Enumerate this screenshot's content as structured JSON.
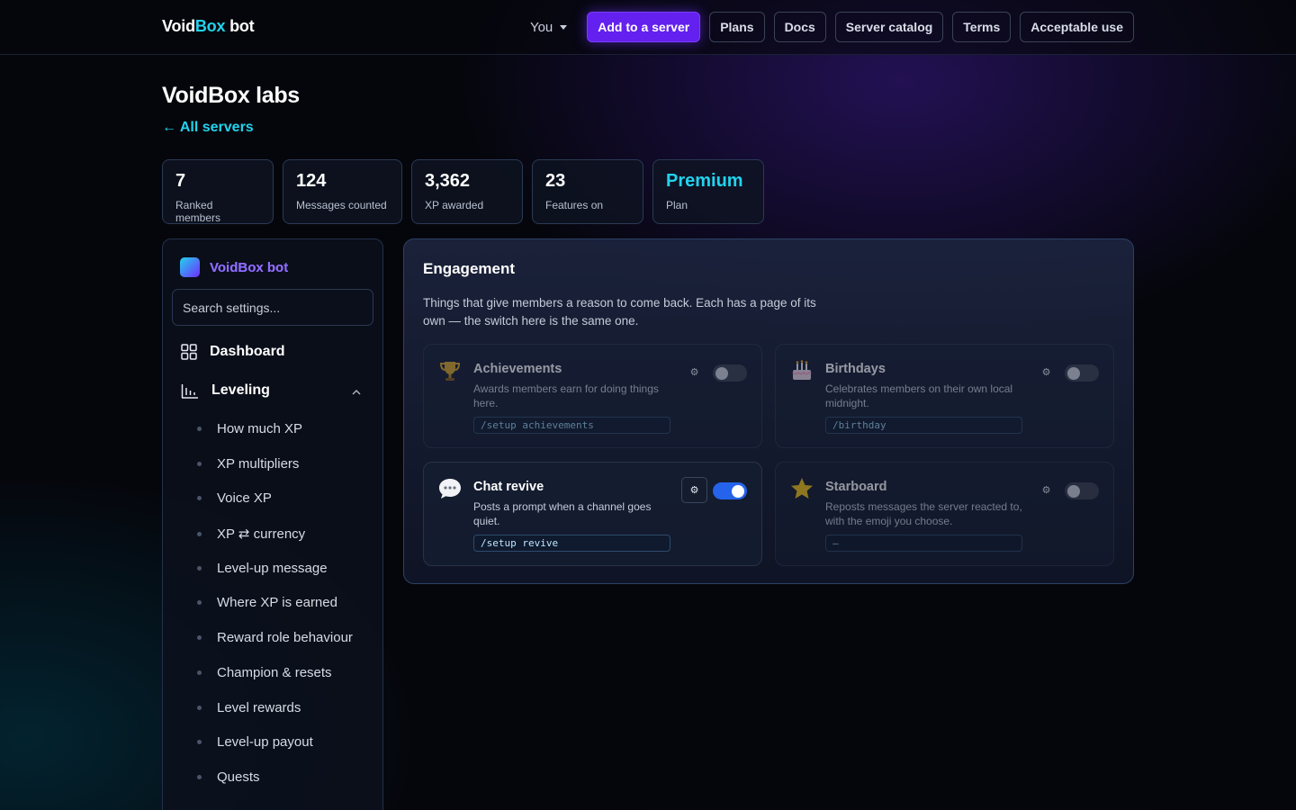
{
  "brand": {
    "prefix": "Void",
    "accent": "Box",
    "suffix": " bot"
  },
  "nav": {
    "user_label": "You",
    "add_label": "Add to a server",
    "links": [
      "Plans",
      "Docs",
      "Server catalog",
      "Terms",
      "Acceptable use"
    ]
  },
  "server": {
    "name": "VoidBox labs",
    "back_label": "← All servers"
  },
  "stats": [
    {
      "value": "7",
      "label": "Ranked members"
    },
    {
      "value": "124",
      "label": "Messages counted"
    },
    {
      "value": "3,362",
      "label": "XP awarded"
    },
    {
      "value": "23",
      "label": "Features on"
    },
    {
      "value": "Premium",
      "label": "Plan"
    }
  ],
  "sidebar": {
    "title": "VoidBox bot",
    "search_placeholder": "Search settings...",
    "dashboard_label": "Dashboard",
    "section_label": "Leveling",
    "sub_items": [
      "How much XP",
      "XP multipliers",
      "Voice XP",
      "XP ⇄ currency",
      "Level-up message",
      "Where XP is earned",
      "Reward role behaviour",
      "Champion & resets",
      "Level rewards",
      "Level-up payout",
      "Quests"
    ]
  },
  "panel": {
    "title": "Engagement",
    "description": "Things that give members a reason to come back. Each has a page of its own — the switch here is the same one.",
    "cards": [
      {
        "icon": "trophy-icon",
        "name": "Achievements",
        "description": "Awards members earn for doing things here.",
        "command": "/setup achievements",
        "enabled": false
      },
      {
        "icon": "cake-icon",
        "name": "Birthdays",
        "description": "Celebrates members on their own local midnight.",
        "command": "/birthday",
        "enabled": false
      },
      {
        "icon": "speech-bubble-icon",
        "name": "Chat revive",
        "description": "Posts a prompt when a channel goes quiet.",
        "command": "/setup revive",
        "enabled": true
      },
      {
        "icon": "star-icon",
        "name": "Starboard",
        "description": "Reposts messages the server reacted to, with the emoji you choose.",
        "command": "—",
        "enabled": false
      }
    ],
    "gear_glyph": "⚙"
  },
  "colors": {
    "accent": "#22d3ee",
    "primary": "#6320ee",
    "toggle_on": "#2563eb"
  }
}
